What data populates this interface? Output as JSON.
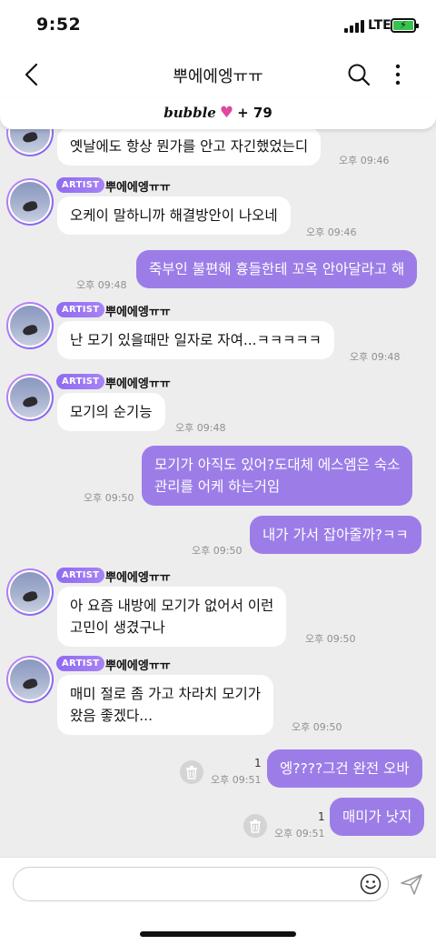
{
  "status_bar": {
    "time": "9:52",
    "network": "LTE"
  },
  "header": {
    "title": "뿌에에엥ㅠㅠ"
  },
  "bubble_bar": {
    "brand": "bubble",
    "count": "+ 79"
  },
  "artist_badge": "ARTIST",
  "artist_name": "뿌에에엥ㅠㅠ",
  "messages": [
    {
      "text": "옛날에도 항상 뭔가를 안고 자긴했었는디",
      "time": "오후 09:46"
    },
    {
      "text": "오케이 말하니까 해결방안이 나오네",
      "time": "오후 09:46"
    },
    {
      "text": "죽부인 불편해 흉들한테 꼬옥 안아달라고 해",
      "time": "오후 09:48"
    },
    {
      "text": "난 모기 있을때만 일자로 자여...ㅋㅋㅋㅋㅋ",
      "time": "오후 09:48"
    },
    {
      "text": "모기의 순기능",
      "time": "오후 09:48"
    },
    {
      "line1": "모기가 아직도 있어?도대체 에스엠은 숙소",
      "line2": "관리를 어케 하는거임",
      "time": "오후 09:50"
    },
    {
      "text": "내가 가서 잡아줄까?ㅋㅋ",
      "time": "오후 09:50"
    },
    {
      "line1": "아 요즘 내방에 모기가 없어서 이런",
      "line2": "고민이 생겼구나",
      "time": "오후 09:50"
    },
    {
      "line1": "매미 절로 좀 가고 차라치 모기가",
      "line2": "왔음 좋겠다...",
      "time": "오후 09:50"
    },
    {
      "text": "엥????그건 완전 오바",
      "time": "오후 09:51",
      "unread": "1"
    },
    {
      "text": "매미가 낫지",
      "time": "오후 09:51",
      "unread": "1"
    }
  ],
  "input": {
    "placeholder": ""
  },
  "icons": {
    "back": "chevron-left-icon",
    "search": "search-icon",
    "more": "more-vertical-icon",
    "heart": "heart-icon",
    "trash": "trash-icon",
    "emoji": "smiley-icon",
    "send": "send-icon"
  },
  "colors": {
    "outgoing_bubble": "#9c7de8",
    "badge": "#8f6bf1",
    "heart": "#e0479f",
    "battery": "#37c34e"
  }
}
